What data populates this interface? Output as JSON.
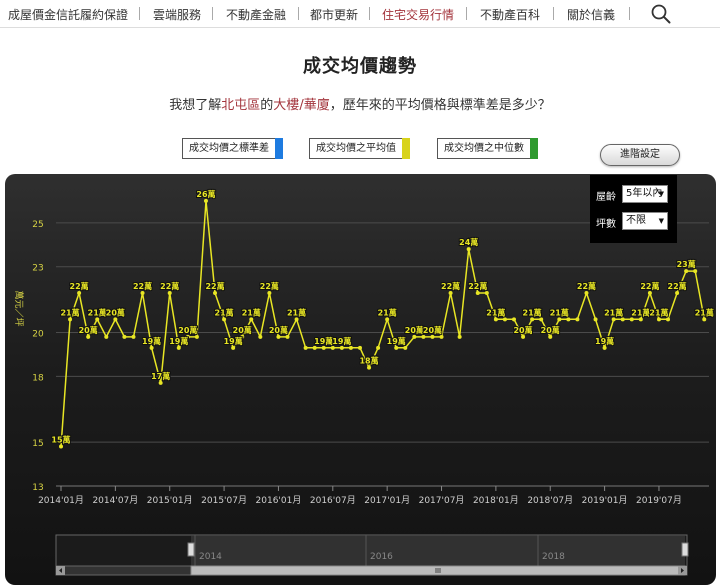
{
  "nav": {
    "items": [
      "成屋價金信託履約保證",
      "雲端服務",
      "不動產金融",
      "都市更新",
      "住宅交易行情",
      "不動產百科",
      "關於信義"
    ],
    "active_index": 4
  },
  "page_title": "成交均價趨勢",
  "question": {
    "p1": "我想了解",
    "district": "北屯區",
    "p2": "的",
    "type1": "大樓",
    "sep": "/",
    "type2": "華廈",
    "p3": "，歷年來的平均價格與標準差是多少？"
  },
  "buttons": {
    "std": "成交均價之標準差",
    "avg": "成交均價之平均值",
    "median": "成交均價之中位數",
    "advanced": "進階設定"
  },
  "filters": {
    "age_label": "屋齡",
    "age_value": "5年以內",
    "size_label": "坪數",
    "size_value": "不限"
  },
  "colors": {
    "accent": "#a3343c",
    "series": "#e8e624",
    "std_indicator": "#1e7be0",
    "avg_indicator": "#d8d31c",
    "median_indicator": "#2f9a2f"
  },
  "chart_data": {
    "type": "line",
    "ylabel": "萬元／坪",
    "ylim": [
      13,
      27
    ],
    "yticks": [
      13,
      15,
      18,
      20,
      23,
      25
    ],
    "xticks": [
      "2014'01月",
      "2014'07月",
      "2015'01月",
      "2015'07月",
      "2016'01月",
      "2016'07月",
      "2017'01月",
      "2017'07月",
      "2018'01月",
      "2018'07月",
      "2019'01月",
      "2019'07月"
    ],
    "navigator_labels": [
      "2014",
      "2016",
      "2018"
    ],
    "x_start": "2014-01",
    "label_suffix": "萬",
    "values": [
      14.8,
      20.6,
      21.8,
      19.8,
      20.6,
      19.8,
      20.6,
      19.8,
      19.8,
      21.8,
      19.3,
      17.7,
      21.8,
      19.3,
      19.8,
      19.8,
      26.0,
      21.8,
      20.6,
      19.3,
      19.8,
      20.6,
      19.8,
      21.8,
      19.8,
      19.8,
      20.6,
      19.3,
      19.3,
      19.3,
      19.3,
      19.3,
      19.3,
      19.3,
      18.4,
      19.3,
      20.6,
      19.3,
      19.3,
      19.8,
      19.8,
      19.8,
      19.8,
      21.8,
      19.8,
      23.8,
      21.8,
      21.8,
      20.6,
      20.6,
      20.6,
      19.8,
      20.6,
      20.6,
      19.8,
      20.6,
      20.6,
      20.6,
      21.8,
      20.6,
      19.3,
      20.6,
      20.6,
      20.6,
      20.6,
      21.8,
      20.6,
      20.6,
      21.8,
      22.8,
      22.8,
      20.6
    ],
    "labels": [
      "15",
      "21",
      "22",
      "20",
      "21",
      "",
      "20",
      "",
      "",
      "22",
      "19",
      "17",
      "22",
      "19",
      "20",
      "",
      "26",
      "22",
      "21",
      "19",
      "20",
      "21",
      "",
      "22",
      "20",
      "",
      "21",
      "",
      "",
      "19",
      "",
      "19",
      "",
      "",
      "18",
      "",
      "21",
      "19",
      "",
      "20",
      "",
      "20",
      "",
      "22",
      "",
      "24",
      "22",
      "",
      "21",
      "",
      "",
      "20",
      "21",
      "",
      "20",
      "21",
      "",
      "",
      "22",
      "",
      "19",
      "21",
      "",
      "",
      "21",
      "22",
      "21",
      "",
      "22",
      "23",
      "",
      "21"
    ]
  }
}
